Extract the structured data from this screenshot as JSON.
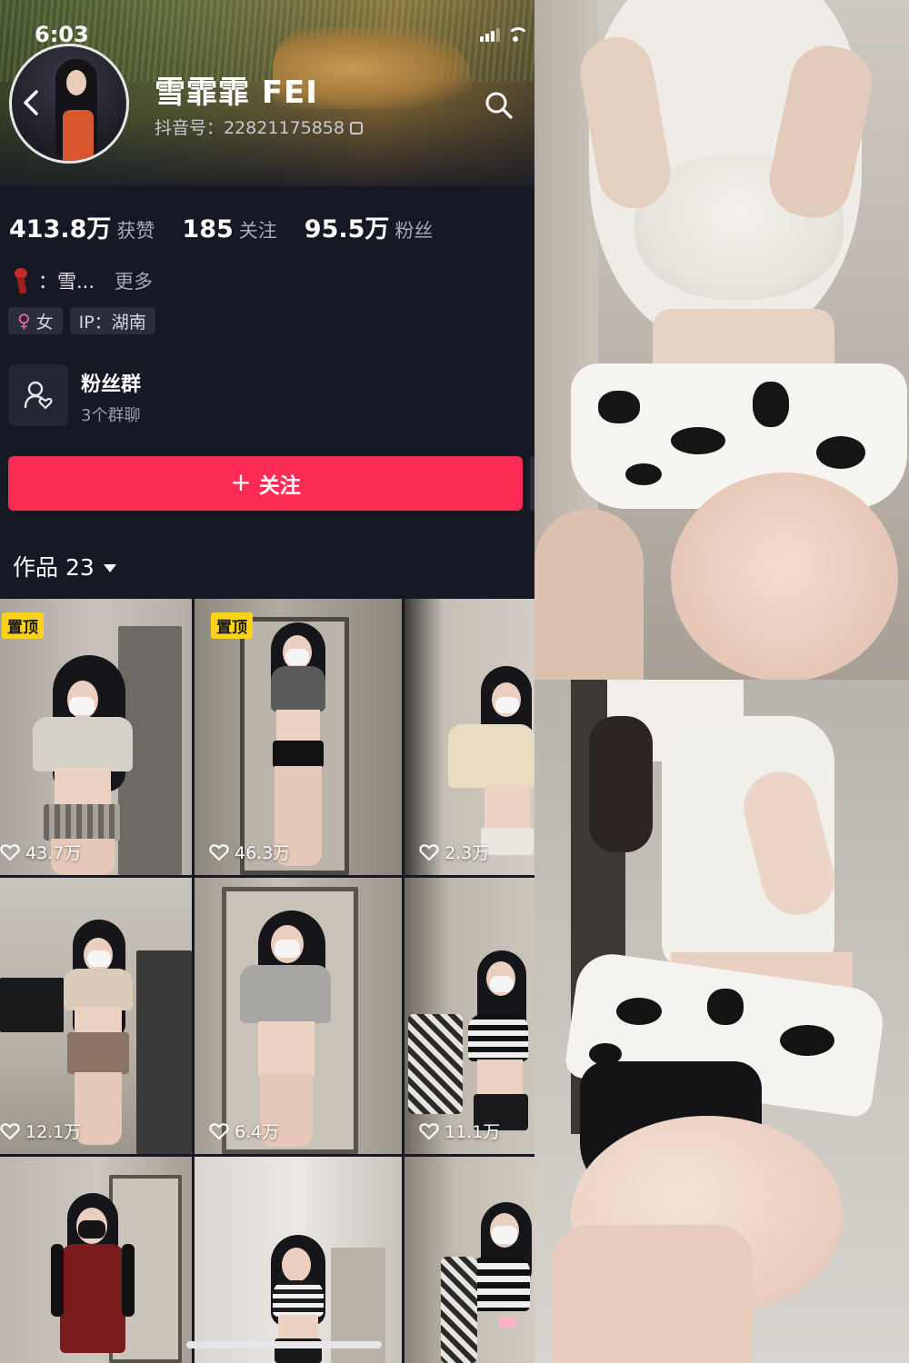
{
  "status_bar": {
    "time": "6:03"
  },
  "profile": {
    "nickname": "雪霏霏 FEI",
    "douyin_id": "抖音号：22821175858",
    "stats": [
      {
        "value": "413.8万",
        "label": "获赞"
      },
      {
        "value": "185",
        "label": "关注"
      },
      {
        "value": "95.5万",
        "label": "粉丝"
      }
    ],
    "bio": "：雪...",
    "bio_more": "更多",
    "tags": [
      {
        "icon": "female-icon",
        "text": "女"
      },
      {
        "icon": "",
        "text": "IP：湖南"
      }
    ],
    "fan_group": {
      "title": "粉丝群",
      "subtitle": "3个群聊"
    },
    "follow_button": "关注",
    "works_label": "作品 23"
  },
  "videos": [
    {
      "pinned": true,
      "pin_label": "置顶",
      "likes": "43.7万"
    },
    {
      "pinned": true,
      "pin_label": "置顶",
      "likes": "46.3万"
    },
    {
      "pinned": false,
      "likes": "2.3万"
    },
    {
      "pinned": false,
      "likes": "12.1万"
    },
    {
      "pinned": false,
      "likes": "6.4万"
    },
    {
      "pinned": false,
      "likes": "11.1万"
    },
    {
      "pinned": false,
      "likes": ""
    },
    {
      "pinned": false,
      "likes": ""
    },
    {
      "pinned": false,
      "likes": ""
    }
  ],
  "colors": {
    "background": "#161824",
    "follow_button": "#fe2c55",
    "pin_badge": "#ffd21a"
  }
}
